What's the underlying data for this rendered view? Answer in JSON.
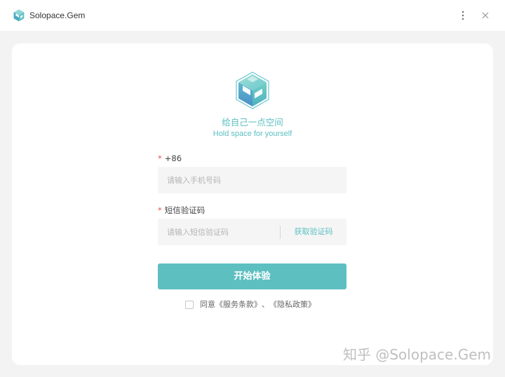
{
  "window": {
    "title": "Solopace.Gem",
    "more_icon": "more-vertical-icon",
    "close_icon": "close-icon"
  },
  "brand": {
    "logo_icon": "solopace-cube-logo",
    "slogan_cn": "给自己一点空间",
    "slogan_en": "Hold space for yourself"
  },
  "form": {
    "phone": {
      "required_mark": "*",
      "label": "+86",
      "placeholder": "请输入手机号码",
      "value": ""
    },
    "code": {
      "required_mark": "*",
      "label": "短信验证码",
      "placeholder": "请输入短信验证码",
      "value": "",
      "get_code_label": "获取验证码"
    },
    "submit_label": "开始体验",
    "agreement": {
      "checked": false,
      "prefix": "同意",
      "service_terms": "《服务条款》",
      "separator": "、",
      "privacy_policy": "《隐私政策》"
    }
  },
  "watermark": "知乎 @Solopace.Gem",
  "colors": {
    "accent": "#5ebfc1",
    "background": "#f3f3f3",
    "required": "#e55454"
  }
}
